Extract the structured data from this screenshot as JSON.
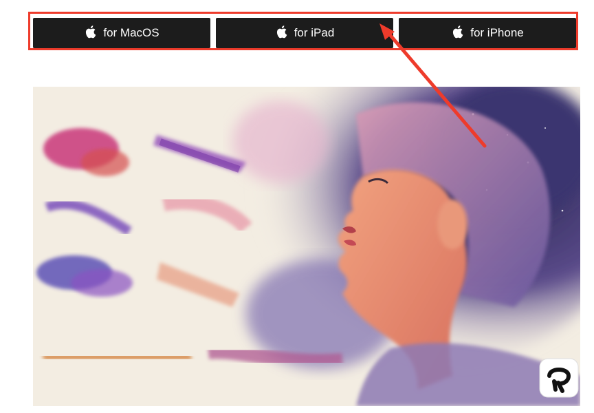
{
  "downloads": {
    "buttons": [
      {
        "label": "for MacOS",
        "icon": "apple-icon"
      },
      {
        "label": "for iPad",
        "icon": "apple-icon"
      },
      {
        "label": "for iPhone",
        "icon": "apple-icon"
      }
    ]
  },
  "hero": {
    "description_icon": "clip-studio-logo-icon"
  },
  "colors": {
    "button_bg": "#1c1c1c",
    "highlight": "#ee3b2b",
    "paper": "#f3ede2"
  }
}
